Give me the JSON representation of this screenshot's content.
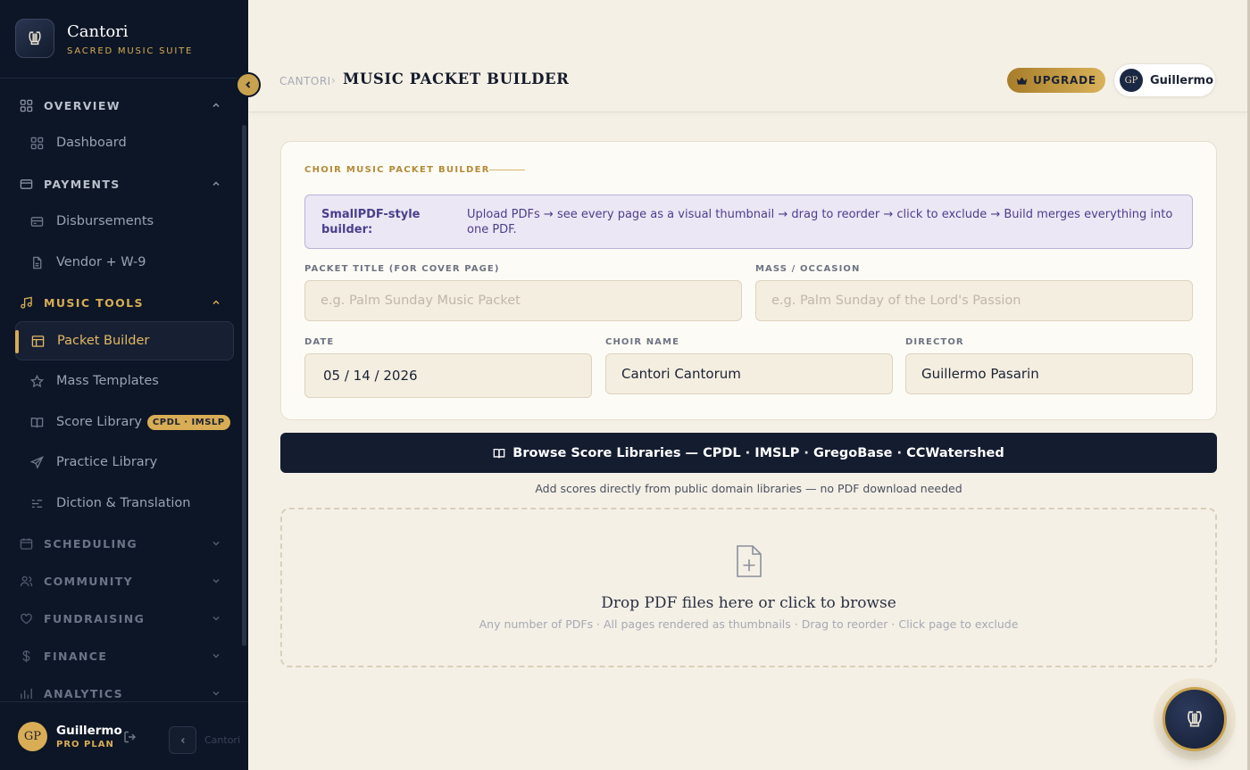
{
  "app": {
    "name": "Cantori",
    "subtitle": "SACRED MUSIC SUITE"
  },
  "sidebar": {
    "sections": [
      {
        "label": "OVERVIEW",
        "expanded": true,
        "items": [
          {
            "label": "Dashboard"
          }
        ]
      },
      {
        "label": "PAYMENTS",
        "expanded": true,
        "items": [
          {
            "label": "Disbursements"
          },
          {
            "label": "Vendor + W-9"
          }
        ]
      },
      {
        "label": "MUSIC TOOLS",
        "expanded": true,
        "items": [
          {
            "label": "Packet Builder",
            "active": true
          },
          {
            "label": "Mass Templates"
          },
          {
            "label": "Score Library",
            "badge": "CPDL · IMSLP"
          },
          {
            "label": "Practice Library"
          },
          {
            "label": "Diction & Translation"
          }
        ]
      },
      {
        "label": "SCHEDULING",
        "expanded": false
      },
      {
        "label": "COMMUNITY",
        "expanded": false
      },
      {
        "label": "FUNDRAISING",
        "expanded": false
      },
      {
        "label": "FINANCE",
        "expanded": false
      },
      {
        "label": "ANALYTICS",
        "expanded": false
      }
    ],
    "footer": {
      "initials": "GP",
      "name": "Guillermo",
      "plan": "PRO PLAN",
      "collapse_text": "Cantori"
    }
  },
  "header": {
    "breadcrumb": "CANTORI",
    "separator": "›",
    "title": "MUSIC PACKET BUILDER",
    "upgrade_label": "UPGRADE",
    "user": {
      "initials": "GP",
      "name": "Guillermo"
    }
  },
  "builder": {
    "kicker": "CHOIR MUSIC PACKET BUILDER",
    "info_strong": "SmallPDF-style builder:",
    "info_text": "Upload PDFs → see every page as a visual thumbnail → drag to reorder → click to exclude → Build merges everything into one PDF.",
    "fields": {
      "packet_title": {
        "label": "PACKET TITLE (FOR COVER PAGE)",
        "value": "",
        "placeholder": "e.g. Palm Sunday Music Packet"
      },
      "mass_occasion": {
        "label": "MASS / OCCASION",
        "value": "",
        "placeholder": "e.g. Palm Sunday of the Lord's Passion"
      },
      "date": {
        "label": "DATE",
        "value": "05 / 14 / 2026"
      },
      "choir_name": {
        "label": "CHOIR NAME",
        "value": "Cantori Cantorum"
      },
      "director": {
        "label": "DIRECTOR",
        "value": "Guillermo Pasarin"
      }
    }
  },
  "browse": {
    "label": "Browse Score Libraries — CPDL · IMSLP · GregoBase · CCWatershed",
    "caption": "Add scores directly from public domain libraries — no PDF download needed"
  },
  "dropzone": {
    "title": "Drop PDF files here or click to browse",
    "subtitle": "Any number of PDFs · All pages rendered as thumbnails · Drag to reorder · Click page to exclude"
  },
  "colors": {
    "sidebar_bg": "#0d1626",
    "accent_gold": "#d8ad55",
    "page_bg": "#f5f0e6",
    "info_bg": "#ebe7f5",
    "info_text": "#4a3f8c",
    "button_dark": "#141c30"
  }
}
